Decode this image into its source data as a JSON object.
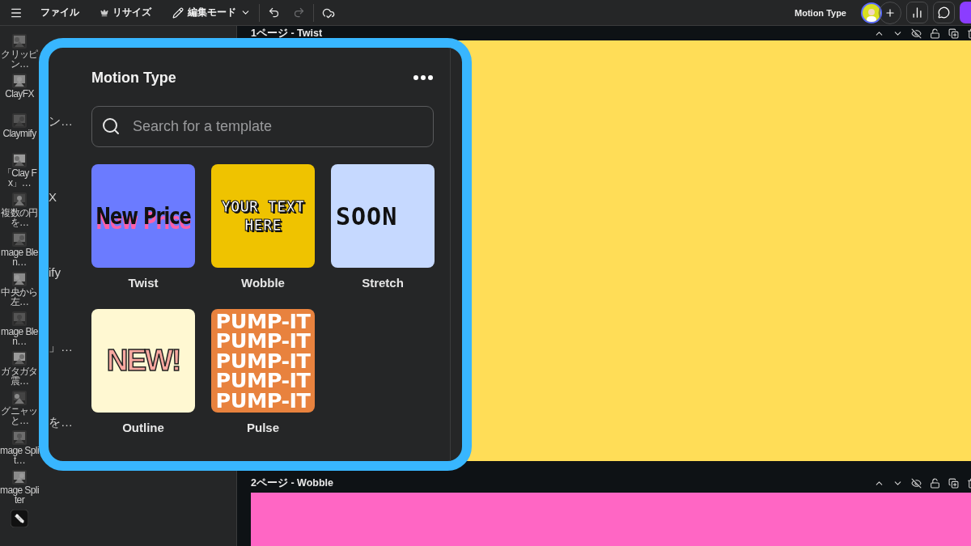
{
  "toolbar": {
    "menu_items": [
      {
        "label": "ファイル",
        "kind": "text"
      },
      {
        "label": "リサイズ",
        "kind": "crown"
      },
      {
        "label": "編集モード",
        "kind": "pencil-dropdown"
      }
    ],
    "history": [
      {
        "kind": "undo",
        "disabled": false
      },
      {
        "kind": "redo",
        "disabled": true
      }
    ],
    "project_title": "Motion Type"
  },
  "rail": [
    {
      "label": "クリッピン…"
    },
    {
      "label": "ClayFX"
    },
    {
      "label": "Claymify"
    },
    {
      "label": "「Clay Fx」…"
    },
    {
      "label": "複数の円を…"
    },
    {
      "label": "mage Blen…"
    },
    {
      "label": "中央から左…"
    },
    {
      "label": "mage Blen…"
    },
    {
      "label": "ガタガタ震…"
    },
    {
      "label": "グニャッと…"
    },
    {
      "label": "mage Split…"
    },
    {
      "label": "mage Spliter"
    }
  ],
  "behind_panel": [
    "ン…",
    "X",
    "ify",
    "」…",
    "を…"
  ],
  "popup": {
    "title": "Motion Type",
    "search": {
      "placeholder": "Search for a template"
    },
    "templates": [
      {
        "name": "Twist",
        "kind": "twist",
        "preview_lines": [
          "New Price"
        ]
      },
      {
        "name": "Wobble",
        "kind": "wobble",
        "preview_lines": [
          "YOUR TEXT",
          "HERE"
        ]
      },
      {
        "name": "Stretch",
        "kind": "stretch",
        "preview_lines": [
          "SOON"
        ]
      },
      {
        "name": "Outline",
        "kind": "outline",
        "preview_lines": [
          "NEW!"
        ]
      },
      {
        "name": "Pulse",
        "kind": "pulse",
        "preview_lines": [
          "PUMP-IT",
          "PUMP-IT",
          "PUMP-IT",
          "PUMP-IT",
          "PUMP-IT"
        ]
      }
    ]
  },
  "pages": [
    {
      "title": "1ページ - Twist",
      "color": "#ffdd57"
    },
    {
      "title": "2ページ - Wobble",
      "color": "#ff66c4"
    }
  ]
}
